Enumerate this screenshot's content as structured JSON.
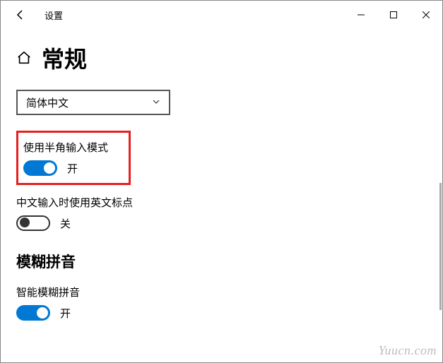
{
  "window": {
    "app_title": "设置"
  },
  "page": {
    "heading": "常规"
  },
  "language_select": {
    "value": "简体中文"
  },
  "settings": {
    "half_width": {
      "label": "使用半角输入模式",
      "state_label": "开",
      "on": true
    },
    "english_punct": {
      "label": "中文输入时使用英文标点",
      "state_label": "关",
      "on": false
    }
  },
  "section": {
    "fuzzy_heading": "模糊拼音",
    "smart_fuzzy": {
      "label": "智能模糊拼音",
      "state_label": "开",
      "on": true
    }
  },
  "watermark": "Yuucn.com"
}
